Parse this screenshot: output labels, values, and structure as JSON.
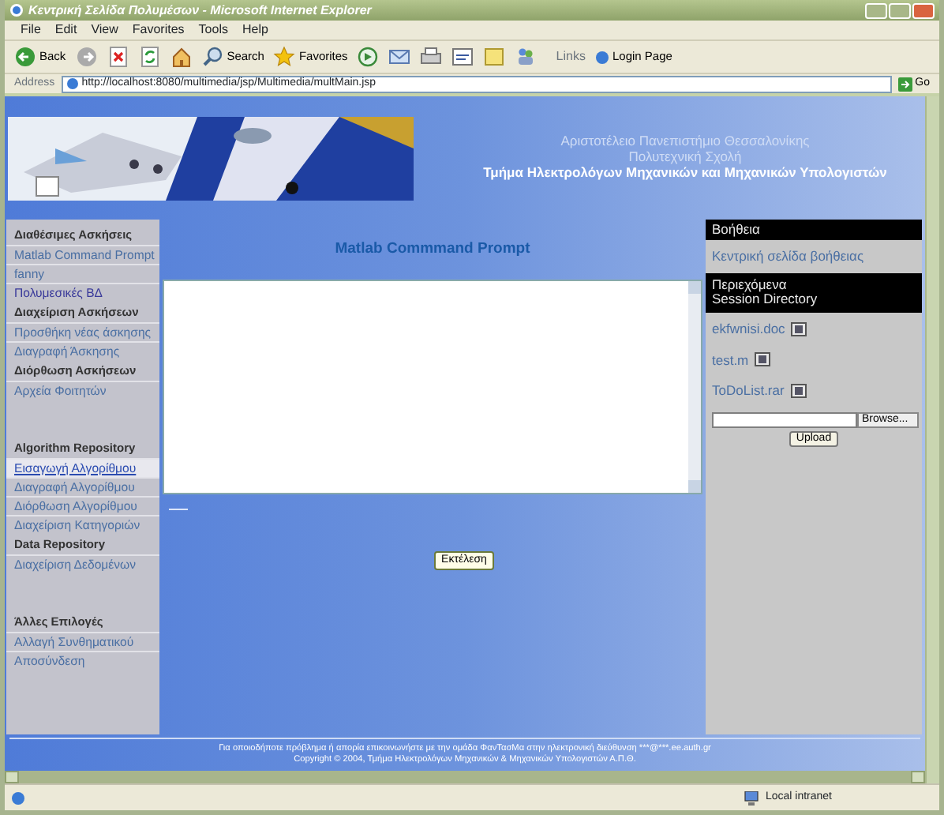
{
  "window": {
    "title": "Κεντρική Σελίδα Πολυμέσων - Microsoft Internet Explorer"
  },
  "menu_bar": [
    "File",
    "Edit",
    "View",
    "Favorites",
    "Tools",
    "Help"
  ],
  "toolbar": {
    "buttons": [
      {
        "kind": "back",
        "label": "Back"
      },
      {
        "kind": "forward"
      },
      {
        "kind": "stop"
      },
      {
        "kind": "refresh"
      },
      {
        "kind": "home"
      },
      {
        "kind": "search",
        "label": "Search"
      },
      {
        "kind": "favorites",
        "label": "Favorites"
      },
      {
        "kind": "media"
      },
      {
        "kind": "mail"
      },
      {
        "kind": "print"
      },
      {
        "kind": "edit"
      },
      {
        "kind": "folder"
      },
      {
        "kind": "messenger"
      }
    ],
    "links_label": "Links",
    "links": [
      "Login Page"
    ]
  },
  "address_bar": {
    "label": "Address",
    "url": "http://localhost:8080/multimedia/jsp/Multimedia/multMain.jsp",
    "go": "Go"
  },
  "banner": {
    "lines": [
      {
        "text": "Αριστοτέλειο Πανεπιστήμιο Θεσσαλονίκης",
        "strong": false
      },
      {
        "text": "Πολυτεχνική Σχολή",
        "strong": false
      },
      {
        "text": "Τμήμα Ηλεκτρολόγων Μηχανικών και Μηχανικών Υπολογιστών",
        "strong": true
      }
    ]
  },
  "sidebar": {
    "groups": [
      {
        "sections": [
          {
            "heading": "Διαθέσιμες Ασκήσεις",
            "links": [
              {
                "label": "Matlab Command Prompt",
                "visited": false,
                "selected": false
              },
              {
                "label": "fanny",
                "visited": false,
                "selected": false
              },
              {
                "label": "Πολυμεσικές ΒΔ",
                "visited": true,
                "selected": false
              }
            ]
          },
          {
            "heading": "Διαχείριση Ασκήσεων",
            "links": [
              {
                "label": "Προσθήκη νέας άσκησης",
                "visited": false,
                "selected": false
              },
              {
                "label": "Διαγραφή Άσκησης",
                "visited": false,
                "selected": false
              }
            ]
          },
          {
            "heading": "Διόρθωση Ασκήσεων",
            "links": [
              {
                "label": "Αρχεία Φοιτητών",
                "visited": false,
                "selected": false
              }
            ]
          }
        ]
      },
      {
        "sections": [
          {
            "heading": "Algorithm Repository",
            "links": [
              {
                "label": "Εισαγωγή Αλγορίθμου",
                "visited": false,
                "selected": true
              },
              {
                "label": "Διαγραφή Αλγορίθμου",
                "visited": false,
                "selected": false
              },
              {
                "label": "Διόρθωση Αλγορίθμου",
                "visited": false,
                "selected": false
              },
              {
                "label": "Διαχείριση Κατηγοριών",
                "visited": false,
                "selected": false
              }
            ]
          },
          {
            "heading": "Data Repository",
            "links": [
              {
                "label": "Διαχείριση Δεδομένων",
                "visited": false,
                "selected": false
              }
            ]
          }
        ]
      },
      {
        "sections": [
          {
            "heading": "Άλλες Επιλογές",
            "links": [
              {
                "label": "Αλλαγή Συνθηματικού",
                "visited": false,
                "selected": false
              },
              {
                "label": "Αποσύνδεση",
                "visited": false,
                "selected": false
              }
            ]
          }
        ]
      }
    ]
  },
  "main": {
    "title": "Matlab Commmand Prompt",
    "run_button": "Εκτέλεση"
  },
  "help_panel": {
    "header": "Βοήθεια",
    "link": "Κεντρική σελίδα βοήθειας",
    "contents_header": [
      "Περιεχόμενα",
      "Session Directory"
    ],
    "files": [
      "ekfwnisi.doc",
      "test.m",
      "ToDoList.rar"
    ],
    "browse_button": "Browse...",
    "upload_button": "Upload"
  },
  "footer": {
    "lines": [
      "Για οποιοδήποτε πρόβλημα ή απορία επικοινωνήστε με την ομάδα ΦανΤασΜα στην ηλεκτρονική διεύθυνση ***@***.ee.auth.gr",
      "Copyright © 2004, Τμήμα Ηλεκτρολόγων Μηχανικών & Μηχανικών Υπολογιστών Α.Π.Θ."
    ]
  },
  "status_bar": {
    "zone": "Local intranet"
  }
}
